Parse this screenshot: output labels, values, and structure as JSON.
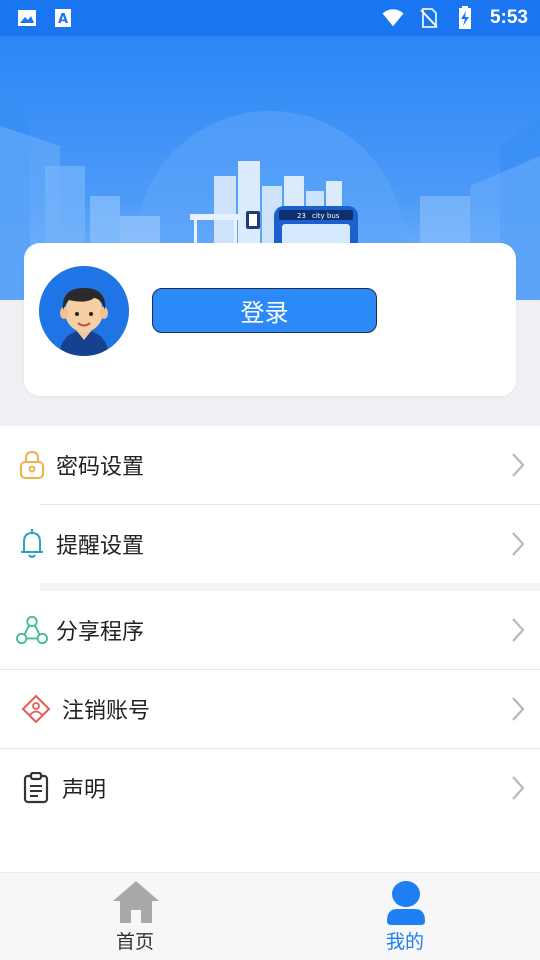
{
  "status_bar": {
    "time": "5:53",
    "icons": [
      "image-icon",
      "text-a-icon",
      "wifi-icon",
      "no-sim-icon",
      "battery-charging-icon"
    ]
  },
  "banner": {
    "bus_label": "city bus",
    "bus_number": "23"
  },
  "profile": {
    "login_label": "登录"
  },
  "menu": {
    "items": [
      {
        "label": "密码设置",
        "icon": "lock-icon"
      },
      {
        "label": "提醒设置",
        "icon": "bell-icon"
      },
      {
        "label": "分享程序",
        "icon": "share-icon"
      },
      {
        "label": "注销账号",
        "icon": "deactivate-account-icon"
      },
      {
        "label": "声明",
        "icon": "clipboard-icon"
      }
    ]
  },
  "bottom_nav": {
    "home_label": "首页",
    "mine_label": "我的"
  },
  "colors": {
    "primary": "#1976f0",
    "button": "#2b8af7",
    "nav_active": "#1e7ef2",
    "nav_inactive": "#9a9a9a"
  }
}
